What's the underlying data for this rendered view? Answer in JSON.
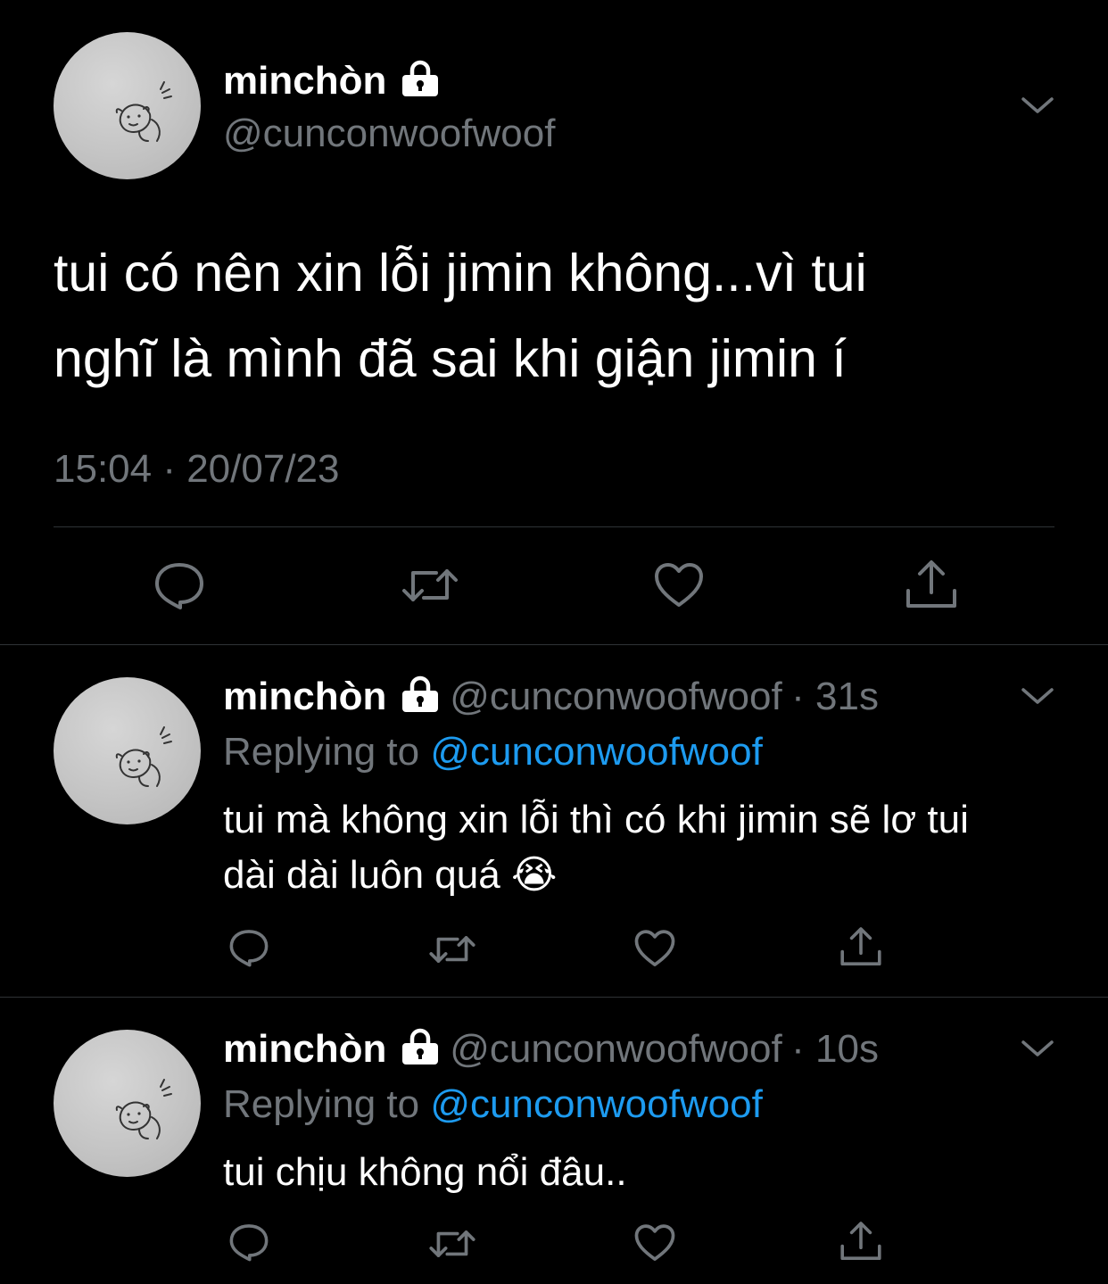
{
  "main_tweet": {
    "display_name": "minchòn",
    "handle": "@cunconwoofwoof",
    "text_line1": "tui có nên xin lỗi jimin không...vì tui",
    "text_line2": "nghĩ là mình đã sai khi giận jimin í",
    "timestamp": "15:04 · 20/07/23"
  },
  "replies": [
    {
      "display_name": "minchòn",
      "handle": "@cunconwoofwoof",
      "time": "· 31s",
      "replying_prefix": "Replying to ",
      "replying_handle": "@cunconwoofwoof",
      "text_line1": "tui mà không xin lỗi thì có khi jimin sẽ lơ tui",
      "text_line2": "dài dài luôn quá",
      "emoji": "😭"
    },
    {
      "display_name": "minchòn",
      "handle": "@cunconwoofwoof",
      "time": "· 10s",
      "replying_prefix": "Replying to ",
      "replying_handle": "@cunconwoofwoof",
      "text_line1": "tui chịu không nổi đâu.."
    }
  ],
  "icons": {
    "lock": "lock-icon",
    "more": "chevron-down-icon",
    "reply": "reply-icon",
    "retweet": "retweet-icon",
    "like": "heart-icon",
    "share": "share-icon"
  },
  "colors": {
    "background": "#000000",
    "text": "#ffffff",
    "secondary": "#71767b",
    "link": "#1d9bf0",
    "divider": "#2f3336"
  }
}
